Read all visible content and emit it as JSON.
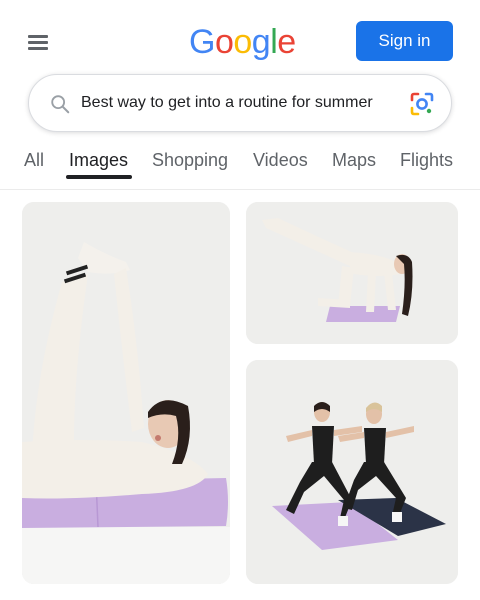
{
  "header": {
    "menu_icon": "hamburger-menu-icon",
    "logo_letters": [
      "G",
      "o",
      "o",
      "g",
      "l",
      "e"
    ],
    "logo_colors": [
      "#4285F4",
      "#EA4335",
      "#FBBC05",
      "#4285F4",
      "#34A853",
      "#EA4335"
    ],
    "signin_label": "Sign in",
    "signin_color": "#1a73e8"
  },
  "search": {
    "query": "Best way to get into a routine for summer",
    "search_icon": "search-icon",
    "lens_icon": "google-lens-icon"
  },
  "tabs": [
    {
      "label": "All",
      "active": false
    },
    {
      "label": "Images",
      "active": true
    },
    {
      "label": "Shopping",
      "active": false
    },
    {
      "label": "Videos",
      "active": false
    },
    {
      "label": "Maps",
      "active": false
    },
    {
      "label": "Flights",
      "active": false
    }
  ],
  "results": [
    {
      "kind": "image",
      "subject": "woman in white outfit doing side-lying leg raise on lavender mat"
    },
    {
      "kind": "image",
      "subject": "woman in white outfit doing kneeling leg extension on lavender mat"
    },
    {
      "kind": "image",
      "subject": "two women in black doing lunge pose on lavender and navy mats"
    }
  ],
  "colors": {
    "mat_lavender": "#c9aee0",
    "mat_navy": "#2b3347",
    "outfit_white": "#f3efe8",
    "outfit_black": "#1e1e1e",
    "studio_bg": "#eeeeec"
  }
}
